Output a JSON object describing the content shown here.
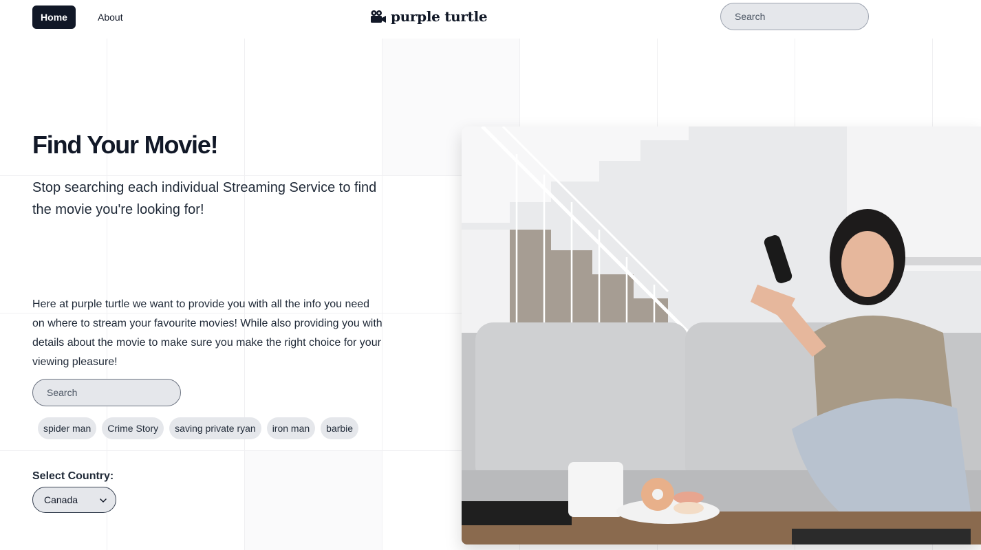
{
  "nav": {
    "home_label": "Home",
    "about_label": "About",
    "brand_name": "purple turtle",
    "brand_icon": "movie-camera-icon",
    "search_placeholder": "Search"
  },
  "hero": {
    "title": "Find Your Movie!",
    "subtitle": "Stop searching each individual Streaming Service to find the movie you're looking for!",
    "description": "Here at purple turtle we want to provide you with all the info you need on where to stream your favourite movies! While also providing you with details about the movie to make sure you make the right choice for your viewing pleasure!",
    "search_placeholder": "Search",
    "suggestions": [
      "spider man",
      "Crime Story",
      "saving private ryan",
      "iron man",
      "barbie"
    ],
    "country_label": "Select Country:",
    "country_value": "Canada",
    "image_subject": "woman on couch holding TV remote"
  },
  "colors": {
    "primary": "#111827",
    "chip_bg": "#e5e7eb",
    "input_bg": "#e5e7eb"
  }
}
